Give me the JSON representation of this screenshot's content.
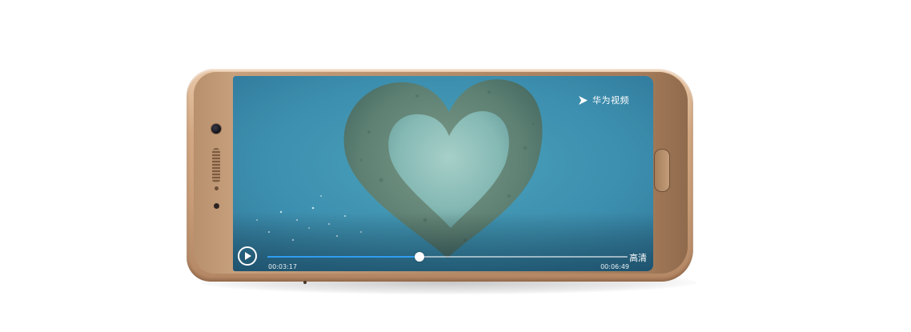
{
  "video_player": {
    "brand_name": "华为视频",
    "current_time": "00:03:17",
    "total_time": "00:06:49",
    "quality_label": "高清",
    "progress_fraction": 0.423,
    "state": "paused",
    "play_icon": "play-icon",
    "brand_icon": "huawei-video-logo-icon"
  },
  "colors": {
    "progress_fill": "#2f9df2",
    "phone_body": "#d2a883",
    "water": "#3f8fae"
  }
}
